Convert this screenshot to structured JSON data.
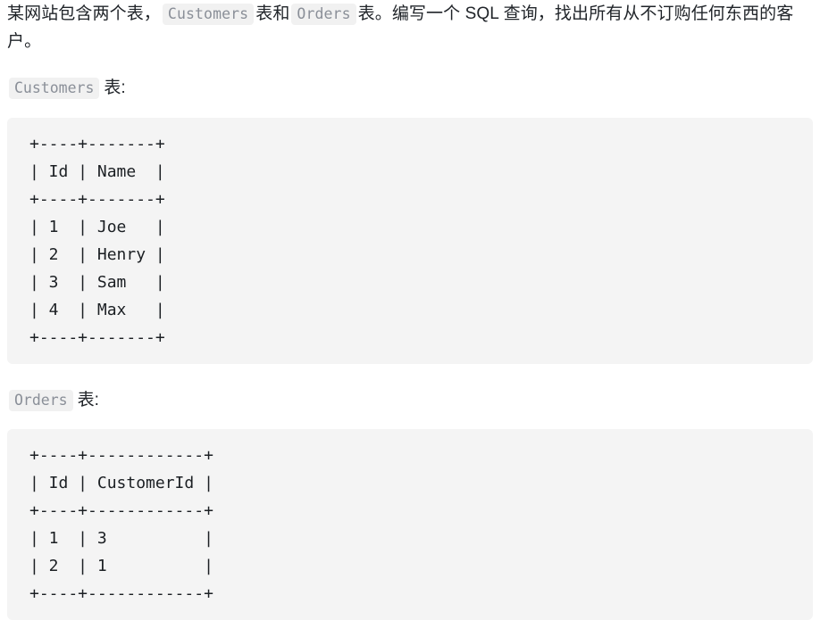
{
  "document": {
    "intro": {
      "segment_1": "某网站包含两个表，",
      "code_1": "Customers",
      "segment_2": "表和",
      "code_2": "Orders",
      "segment_3": "表。编写一个 SQL 查询，找出所有从不订购任何东西的客户。"
    },
    "customers_label": {
      "code": "Customers",
      "suffix": "表:"
    },
    "customers_block": {
      "text": "+----+-------+\n| Id | Name  |\n+----+-------+\n| 1  | Joe   |\n| 2  | Henry |\n| 3  | Sam   |\n| 4  | Max   |\n+----+-------+",
      "columns": [
        "Id",
        "Name"
      ],
      "rows": [
        [
          "1",
          "Joe"
        ],
        [
          "2",
          "Henry"
        ],
        [
          "3",
          "Sam"
        ],
        [
          "4",
          "Max"
        ]
      ]
    },
    "orders_label": {
      "code": "Orders",
      "suffix": "表:"
    },
    "orders_block": {
      "text": "+----+------------+\n| Id | CustomerId |\n+----+------------+\n| 1  | 3          |\n| 2  | 1          |\n+----+------------+",
      "columns": [
        "Id",
        "CustomerId"
      ],
      "rows": [
        [
          "1",
          "3"
        ],
        [
          "2",
          "1"
        ]
      ]
    }
  },
  "colors": {
    "page_background": "#ffffff",
    "code_block_background": "#f4f4f4",
    "inline_code_background": "#f1f1f1",
    "inline_code_text": "#8a8f98",
    "body_text": "#1f2328",
    "code_text": "#1b1f23"
  }
}
